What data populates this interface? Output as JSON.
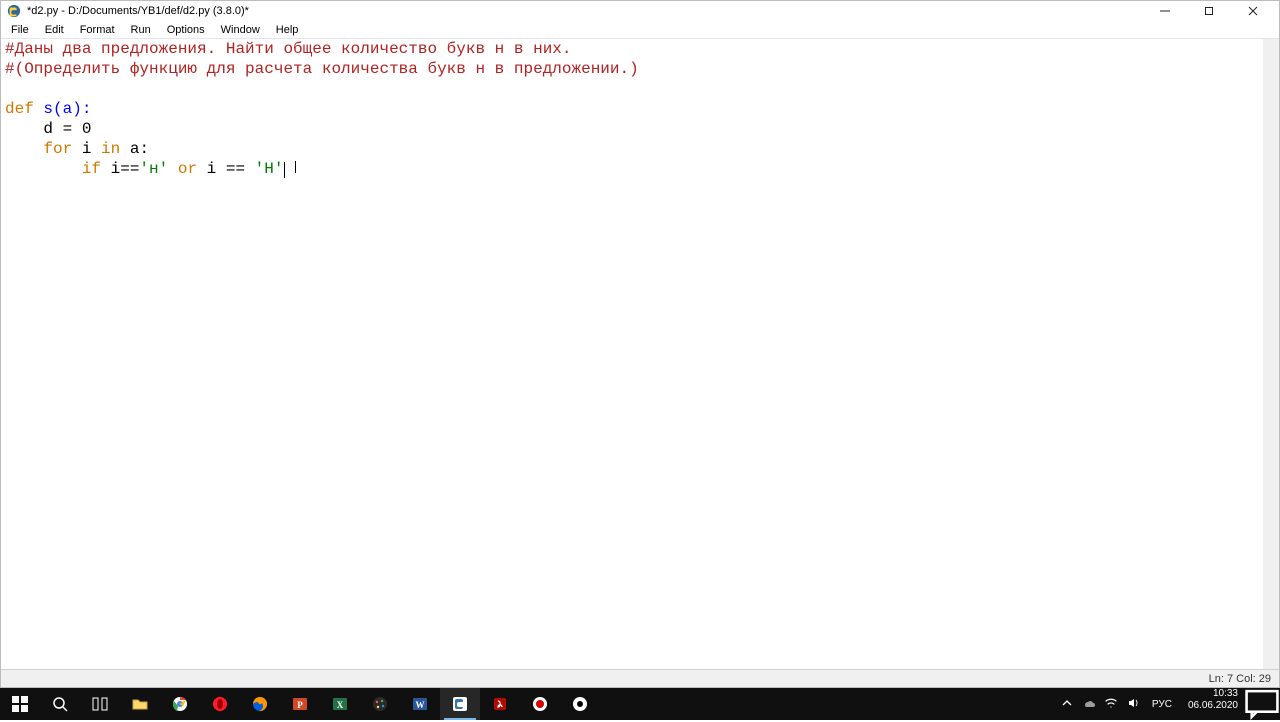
{
  "window": {
    "title": "*d2.py - D:/Documents/YB1/def/d2.py (3.8.0)*"
  },
  "menu": {
    "items": [
      "File",
      "Edit",
      "Format",
      "Run",
      "Options",
      "Window",
      "Help"
    ]
  },
  "code": {
    "line1": "#Даны два предложения. Найти общее количество букв н в них.",
    "line2": "#(Определить функцию для расчета количества букв н в предложении.)",
    "kw_def": "def",
    "def_name": " s(a):",
    "indent1": "    d = 0",
    "kw_for": "for",
    "for_mid": " i ",
    "kw_in": "in",
    "for_tail": " a:",
    "kw_if": "if",
    "if_mid1": " i==",
    "str1": "'н'",
    "kw_or": "or",
    "if_mid2": " i == ",
    "str2": "'Н'"
  },
  "statusbar": {
    "pos": "Ln: 7  Col: 29"
  },
  "systray": {
    "lang": "РУС",
    "time": "10:33",
    "date": "06.06.2020"
  }
}
